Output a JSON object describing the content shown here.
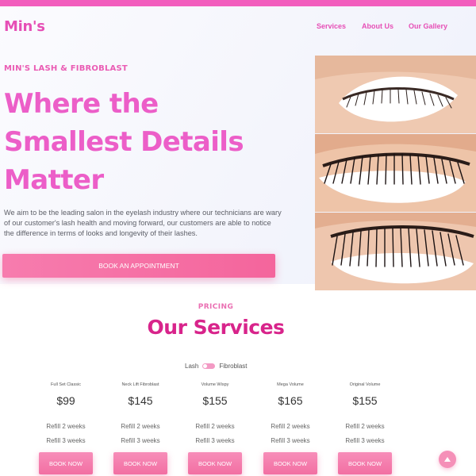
{
  "header": {
    "brand": "Min's",
    "nav": [
      "Services",
      "About Us",
      "Our Gallery"
    ]
  },
  "hero": {
    "eyebrow": "MIN'S LASH & FIBROBLAST",
    "headline": [
      "Where the",
      "Smallest Details",
      "Matter"
    ],
    "description": "We aim to be the leading salon in the eyelash industry where our technicians are wary of our customer's lash health and moving forward, our customers are able to notice the difference in terms of looks and longevity of their lashes.",
    "cta": "BOOK AN APPOINTMENT",
    "gallery_alt": [
      "classic lash extension photo",
      "volume lash extension photo",
      "mega volume lash extension photo"
    ]
  },
  "services": {
    "label": "PRICING",
    "title": "Our Services",
    "toggle": {
      "left": "Lash",
      "right": "Fibroblast",
      "selected": "Lash"
    },
    "plans": [
      {
        "name": "Full Set Classic",
        "price": "$99",
        "refill_2": "Refill 2 weeks",
        "refill_3": "Refill 3 weeks",
        "button": "BOOK NOW"
      },
      {
        "name": "Neck Lift Fibroblast",
        "price": "$145",
        "refill_2": "Refill 2 weeks",
        "refill_3": "Refill 3 weeks",
        "button": "BOOK NOW"
      },
      {
        "name": "Volume Wispy",
        "price": "$155",
        "refill_2": "Refill 2 weeks",
        "refill_3": "Refill 3 weeks",
        "button": "BOOK NOW"
      },
      {
        "name": "Mega Volume",
        "price": "$165",
        "refill_2": "Refill 2 weeks",
        "refill_3": "Refill 3 weeks",
        "button": "BOOK NOW"
      },
      {
        "name": "Original Volume",
        "price": "$155",
        "refill_2": "Refill 2 weeks",
        "refill_3": "Refill 3 weeks",
        "button": "BOOK NOW"
      }
    ]
  },
  "icons": {
    "scroll_top": "chevron-up-icon"
  },
  "colors": {
    "accent": "#f25dbd",
    "headline": "#ec5ec8",
    "button": "#f4659c",
    "title": "#d8248b"
  }
}
